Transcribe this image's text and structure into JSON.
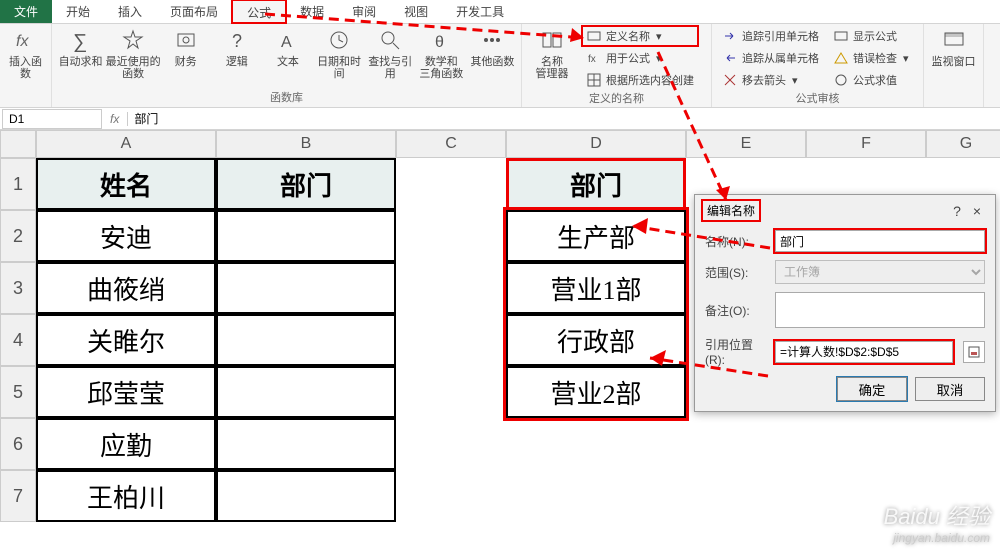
{
  "tabs": {
    "file": "文件",
    "home": "开始",
    "insert": "插入",
    "layout": "页面布局",
    "formula": "公式",
    "data": "数据",
    "review": "审阅",
    "view": "视图",
    "dev": "开发工具"
  },
  "ribbon": {
    "insert_fn": "插入函数",
    "autosum": "自动求和",
    "recent": "最近使用的\n函数",
    "financial": "财务",
    "logical": "逻辑",
    "text_fn": "文本",
    "datetime": "日期和时间",
    "lookup": "查找与引用",
    "math": "数学和\n三角函数",
    "other_fn": "其他函数",
    "lib_label": "函数库",
    "name_mgr": "名称\n管理器",
    "define_name": "定义名称",
    "use_in_formula": "用于公式",
    "create_from_sel": "根据所选内容创建",
    "names_label": "定义的名称",
    "trace_prec": "追踪引用单元格",
    "trace_dep": "追踪从属单元格",
    "remove_arrows": "移去箭头",
    "show_formulas": "显示公式",
    "error_check": "错误检查",
    "eval": "公式求值",
    "audit_label": "公式审核",
    "watch": "监视窗口"
  },
  "fbar": {
    "name": "D1",
    "value": "部门"
  },
  "cols": [
    "A",
    "B",
    "C",
    "D",
    "E",
    "F",
    "G"
  ],
  "rows": [
    "1",
    "2",
    "3",
    "4",
    "5",
    "6",
    "7"
  ],
  "cells": {
    "A1": "姓名",
    "B1": "部门",
    "D1": "部门",
    "A2": "安迪",
    "D2": "生产部",
    "A3": "曲筱绡",
    "D3": "营业1部",
    "A4": "关睢尔",
    "D4": "行政部",
    "A5": "邱莹莹",
    "D5": "营业2部",
    "A6": "应勤",
    "A7": "王柏川"
  },
  "dialog": {
    "title": "编辑名称",
    "name_lbl": "名称(N):",
    "name_val": "部门",
    "scope_lbl": "范围(S):",
    "scope_val": "工作簿",
    "comment_lbl": "备注(O):",
    "ref_lbl": "引用位置(R):",
    "ref_val": "=计算人数!$D$2:$D$5",
    "ok": "确定",
    "cancel": "取消",
    "help": "?",
    "close": "×"
  },
  "watermark": {
    "brand": "Baidu 经验",
    "url": "jingyan.baidu.com"
  }
}
